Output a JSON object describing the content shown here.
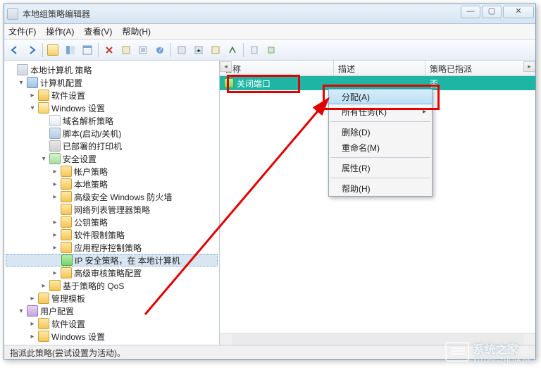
{
  "window": {
    "title": "本地组策略编辑器"
  },
  "menu": {
    "file": "文件(F)",
    "action": "操作(A)",
    "view": "查看(V)",
    "help": "帮助(H)"
  },
  "toolbar_icons": [
    "back-icon",
    "forward-icon",
    "up-icon",
    "show-tree-icon",
    "properties-pane-icon",
    "delete-icon",
    "properties-icon",
    "refresh-icon",
    "export-icon",
    "help-icon",
    "play-icon",
    "stop-icon",
    "lock-icon",
    "add-icon",
    "filter-icon"
  ],
  "tree": [
    {
      "level": 0,
      "exp": "",
      "icon": "ico-mmc",
      "label": "本地计算机 策略"
    },
    {
      "level": 1,
      "exp": "▾",
      "icon": "ico-computer",
      "label": "计算机配置"
    },
    {
      "level": 2,
      "exp": "▸",
      "icon": "ico-folder",
      "label": "软件设置"
    },
    {
      "level": 2,
      "exp": "▾",
      "icon": "ico-folder-open",
      "label": "Windows 设置"
    },
    {
      "level": 3,
      "exp": "",
      "icon": "ico-doc",
      "label": "域名解析策略"
    },
    {
      "level": 3,
      "exp": "",
      "icon": "ico-script",
      "label": "脚本(启动/关机)"
    },
    {
      "level": 3,
      "exp": "",
      "icon": "ico-printer",
      "label": "已部署的打印机"
    },
    {
      "level": 3,
      "exp": "▾",
      "icon": "ico-shield",
      "label": "安全设置"
    },
    {
      "level": 4,
      "exp": "▸",
      "icon": "ico-folder",
      "label": "帐户策略"
    },
    {
      "level": 4,
      "exp": "▸",
      "icon": "ico-folder",
      "label": "本地策略"
    },
    {
      "level": 4,
      "exp": "▸",
      "icon": "ico-folder",
      "label": "高级安全 Windows 防火墙"
    },
    {
      "level": 4,
      "exp": "",
      "icon": "ico-folder",
      "label": "网络列表管理器策略"
    },
    {
      "level": 4,
      "exp": "▸",
      "icon": "ico-folder",
      "label": "公钥策略"
    },
    {
      "level": 4,
      "exp": "▸",
      "icon": "ico-folder",
      "label": "软件限制策略"
    },
    {
      "level": 4,
      "exp": "▸",
      "icon": "ico-folder",
      "label": "应用程序控制策略"
    },
    {
      "level": 4,
      "exp": "",
      "icon": "ico-green",
      "label": "IP 安全策略，在 本地计算机",
      "selected": true
    },
    {
      "level": 4,
      "exp": "▸",
      "icon": "ico-folder",
      "label": "高级审核策略配置"
    },
    {
      "level": 3,
      "exp": "▸",
      "icon": "ico-folder",
      "label": "基于策略的 QoS"
    },
    {
      "level": 2,
      "exp": "▸",
      "icon": "ico-folder",
      "label": "管理模板"
    },
    {
      "level": 1,
      "exp": "▾",
      "icon": "ico-user",
      "label": "用户配置"
    },
    {
      "level": 2,
      "exp": "▸",
      "icon": "ico-folder",
      "label": "软件设置"
    },
    {
      "level": 2,
      "exp": "▸",
      "icon": "ico-folder",
      "label": "Windows 设置"
    }
  ],
  "list": {
    "columns": {
      "name": "名称",
      "desc": "描述",
      "policy": "策略已指派"
    },
    "rows": [
      {
        "name": "关闭端口",
        "desc": "",
        "policy": "否",
        "selected": true
      }
    ]
  },
  "context_menu": {
    "assign": "分配(A)",
    "all_tasks": "所有任务(K)",
    "delete": "删除(D)",
    "rename": "重命名(M)",
    "properties": "属性(R)",
    "help": "帮助(H)"
  },
  "statusbar": "指派此策略(尝试设置为活动)。",
  "watermark": {
    "text_top": "系统之家",
    "text_bottom": "XITONGZHIJIA.NET"
  }
}
